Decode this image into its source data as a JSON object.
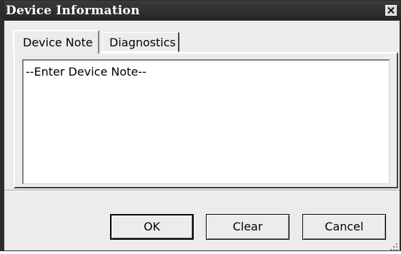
{
  "window": {
    "title": "Device Information"
  },
  "tabs": [
    {
      "label": "Device Note",
      "active": true
    },
    {
      "label": "Diagnostics",
      "active": false
    }
  ],
  "note": {
    "value": "--Enter Device Note--"
  },
  "buttons": {
    "ok_label": "OK",
    "clear_label": "Clear",
    "cancel_label": "Cancel"
  },
  "icons": {
    "close": "close-icon",
    "resize_grip": "resize-grip-icon"
  },
  "colors": {
    "titlebar": "#2d2d2d",
    "title_text": "#ffffff",
    "dialog_bg": "#ececec",
    "field_bg": "#ffffff"
  }
}
